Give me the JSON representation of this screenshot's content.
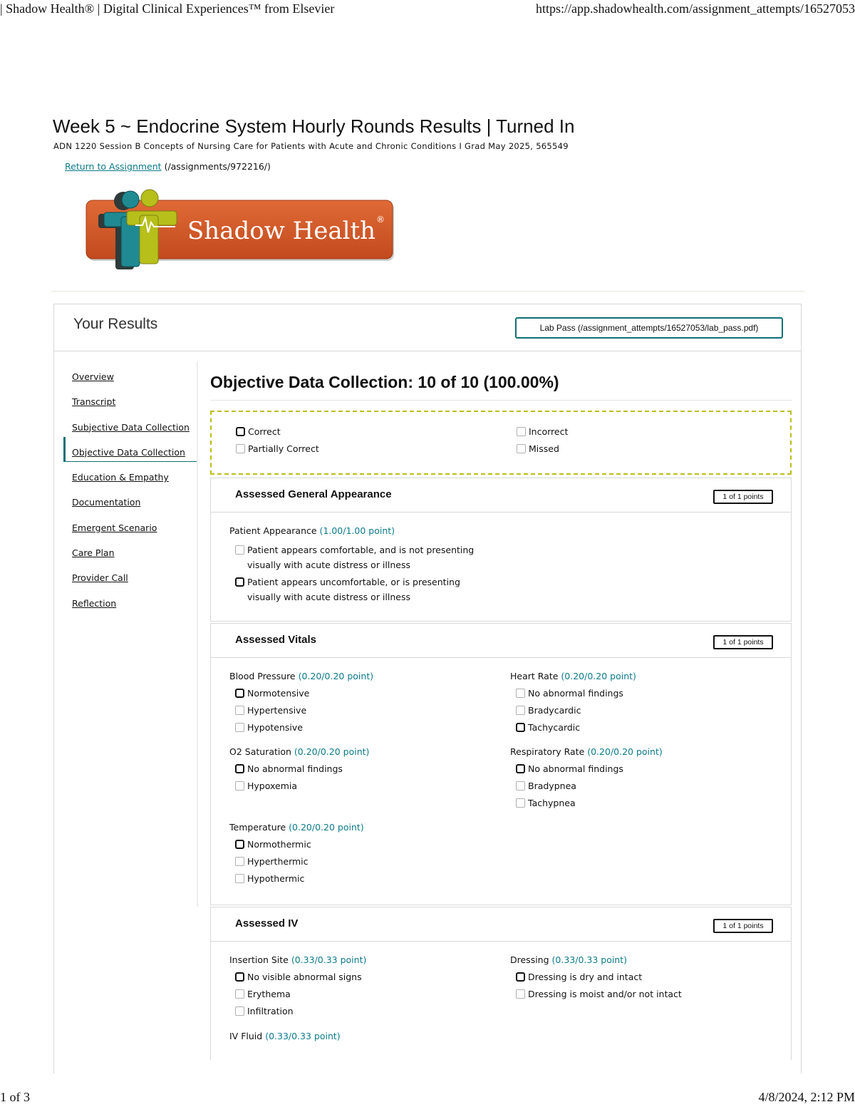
{
  "print_header": {
    "left": "| Shadow Health® | Digital Clinical Experiences™ from Elsevier",
    "right": "https://app.shadowhealth.com/assignment_attempts/16527053"
  },
  "print_footer": {
    "left": "1 of 3",
    "right": "4/8/2024, 2:12 PM"
  },
  "page": {
    "title": "Week 5 ~ Endocrine System Hourly Rounds Results | Turned In",
    "course": "ADN 1220 Session B Concepts of Nursing Care for Patients with Acute and Chronic Conditions I Grad May 2025, 565549",
    "return_link": "Return to Assignment",
    "return_path": "(/assignments/972216/)"
  },
  "logo": {
    "text": "Shadow Health",
    "mark": "®"
  },
  "results": {
    "title": "Your Results",
    "lab_pass": "Lab Pass (/assignment_attempts/16527053/lab_pass.pdf)"
  },
  "nav": [
    "Overview",
    "Transcript",
    "Subjective Data Collection",
    "Objective Data Collection",
    "Education & Empathy",
    "Documentation",
    "Emergent Scenario",
    "Care Plan",
    "Provider Call",
    "Reflection"
  ],
  "content_title": "Objective Data Collection: 10 of 10 (100.00%)",
  "legend": {
    "correct": "Correct",
    "incorrect": "Incorrect",
    "partial": "Partially Correct",
    "missed": "Missed"
  },
  "sections": {
    "general": {
      "title": "Assessed General Appearance",
      "points": "1 of 1 points",
      "q1": {
        "label": "Patient Appearance",
        "score": "(1.00/1.00 point)",
        "o1": "Patient appears comfortable, and is not presenting visually with acute distress or illness",
        "o2": "Patient appears uncomfortable, or is presenting visually with acute distress or illness"
      }
    },
    "vitals": {
      "title": "Assessed Vitals",
      "points": "1 of 1 points",
      "bp": {
        "label": "Blood Pressure",
        "score": "(0.20/0.20 point)",
        "o1": "Normotensive",
        "o2": "Hypertensive",
        "o3": "Hypotensive"
      },
      "hr": {
        "label": "Heart Rate",
        "score": "(0.20/0.20 point)",
        "o1": "No abnormal findings",
        "o2": "Bradycardic",
        "o3": "Tachycardic"
      },
      "o2": {
        "label": "O2 Saturation",
        "score": "(0.20/0.20 point)",
        "o1": "No abnormal findings",
        "o2": "Hypoxemia"
      },
      "rr": {
        "label": "Respiratory Rate",
        "score": "(0.20/0.20 point)",
        "o1": "No abnormal findings",
        "o2": "Bradypnea",
        "o3": "Tachypnea"
      },
      "temp": {
        "label": "Temperature",
        "score": "(0.20/0.20 point)",
        "o1": "Normothermic",
        "o2": "Hyperthermic",
        "o3": "Hypothermic"
      }
    },
    "iv": {
      "title": "Assessed IV",
      "points": "1 of 1 points",
      "site": {
        "label": "Insertion Site",
        "score": "(0.33/0.33 point)",
        "o1": "No visible abnormal signs",
        "o2": "Erythema",
        "o3": "Infiltration"
      },
      "dressing": {
        "label": "Dressing",
        "score": "(0.33/0.33 point)",
        "o1": "Dressing is dry and intact",
        "o2": "Dressing is moist and/or not intact"
      },
      "fluid": {
        "label": "IV Fluid",
        "score": "(0.33/0.33 point)"
      }
    }
  },
  "colors": {
    "teal": "#0f6f76",
    "link": "#0b7a8a",
    "logo_orange": "#d4582a",
    "logo_lime": "#b7bf1a",
    "legend_border": "#bdbd1a"
  }
}
